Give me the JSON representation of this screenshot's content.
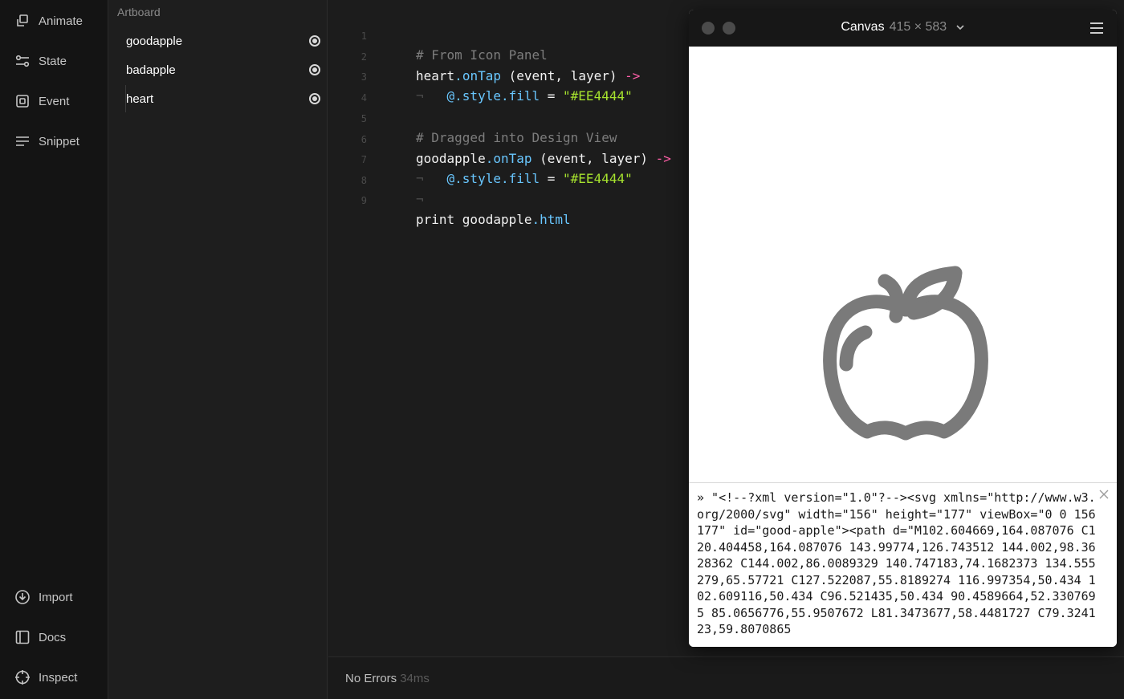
{
  "sidebar": {
    "top_items": [
      {
        "label": "Animate",
        "icon": "animate-icon"
      },
      {
        "label": "State",
        "icon": "state-icon"
      },
      {
        "label": "Event",
        "icon": "event-icon"
      },
      {
        "label": "Snippet",
        "icon": "snippet-icon"
      }
    ],
    "bottom_items": [
      {
        "label": "Import",
        "icon": "import-icon"
      },
      {
        "label": "Docs",
        "icon": "docs-icon"
      },
      {
        "label": "Inspect",
        "icon": "inspect-icon"
      }
    ]
  },
  "layers": {
    "title": "Artboard",
    "items": [
      {
        "label": "goodapple"
      },
      {
        "label": "badapple"
      },
      {
        "label": "heart"
      }
    ]
  },
  "editor": {
    "line_numbers": [
      "1",
      "2",
      "3",
      "4",
      "5",
      "6",
      "7",
      "8",
      "9"
    ],
    "lines": {
      "l1": {
        "comment": "# From Icon Panel"
      },
      "l2": {
        "obj": "heart",
        "dot": ".",
        "method": "onTap",
        "args": " (event, layer) ",
        "arrow": "->"
      },
      "l3": {
        "ws": "¬   ",
        "prop": "@.style.fill",
        "eq": " = ",
        "str": "\"#EE4444\""
      },
      "l5": {
        "comment": "# Dragged into Design View"
      },
      "l6": {
        "obj": "goodapple",
        "dot": ".",
        "method": "onTap",
        "args": " (event, layer) ",
        "arrow": "->"
      },
      "l7": {
        "ws": "¬   ",
        "prop": "@.style.fill",
        "eq": " = ",
        "str": "\"#EE4444\""
      },
      "l8": {
        "ws": "¬"
      },
      "l9": {
        "kw": "print goodapple",
        "prop": ".html"
      }
    }
  },
  "status": {
    "text": "No Errors",
    "time": "34ms"
  },
  "canvas": {
    "title": "Canvas",
    "size": "415 × 583",
    "icon_fill": "#7a7a7a",
    "console_output": "» \"<!--?xml version=\"1.0\"?--><svg xmlns=\"http://www.w3.org/2000/svg\" width=\"156\" height=\"177\" viewBox=\"0 0 156 177\" id=\"good-apple\"><path d=\"M102.604669,164.087076 C120.404458,164.087076 143.99774,126.743512 144.002,98.3628362 C144.002,86.0089329 140.747183,74.1682373 134.555279,65.57721 C127.522087,55.8189274 116.997354,50.434 102.609116,50.434 C96.521435,50.434 90.4589664,52.3307695 85.0656776,55.9507672 L81.3473677,58.4481727 C79.324123,59.8070865"
  },
  "colors": {
    "accent_arrow": "#ff5fa8",
    "string": "#a6e22e",
    "property": "#69c7ff"
  }
}
